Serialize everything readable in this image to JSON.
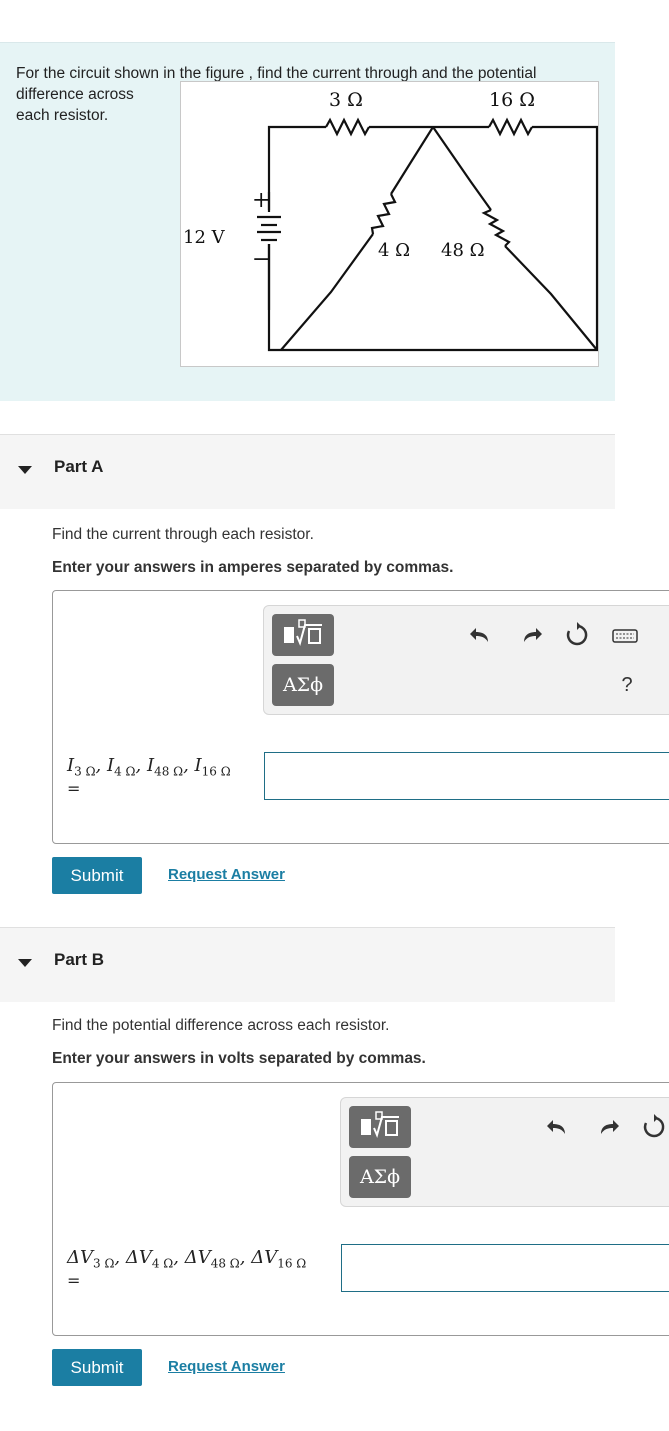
{
  "problem": {
    "line1": "For the circuit shown in the figure , find the current through and the potential",
    "line2": "difference across",
    "line3": "each resistor.",
    "figure": {
      "r3": "3 Ω",
      "r16": "16 Ω",
      "r4": "4 Ω",
      "r48": "48 Ω",
      "battery": "12 V",
      "plus": "+",
      "minus": "−"
    }
  },
  "partA": {
    "title": "Part A",
    "instruction": "Find the current through each resistor.",
    "instruction_bold": "Enter your answers in amperes separated by commas.",
    "toolbar": {
      "templates_icon": "templates-icon",
      "symbols_label": "ΑΣϕ",
      "help_label": "?"
    },
    "label_html_parts": [
      "I",
      "3 Ω",
      ", I",
      "4 Ω",
      ", I",
      "48 Ω",
      ", I",
      "16 Ω"
    ],
    "equals": "=",
    "input_value": "",
    "submit_label": "Submit",
    "request_label": "Request Answer"
  },
  "partB": {
    "title": "Part B",
    "instruction": "Find the potential difference across each resistor.",
    "instruction_bold": "Enter your answers in volts separated by commas.",
    "toolbar": {
      "templates_icon": "templates-icon",
      "symbols_label": "ΑΣϕ"
    },
    "label_parts": [
      "ΔV",
      "3 Ω",
      ", ΔV",
      "4 Ω",
      ", ΔV",
      "48 Ω",
      ", ΔV",
      "16 Ω"
    ],
    "equals": "=",
    "input_value": "",
    "submit_label": "Submit",
    "request_label": "Request Answer"
  }
}
